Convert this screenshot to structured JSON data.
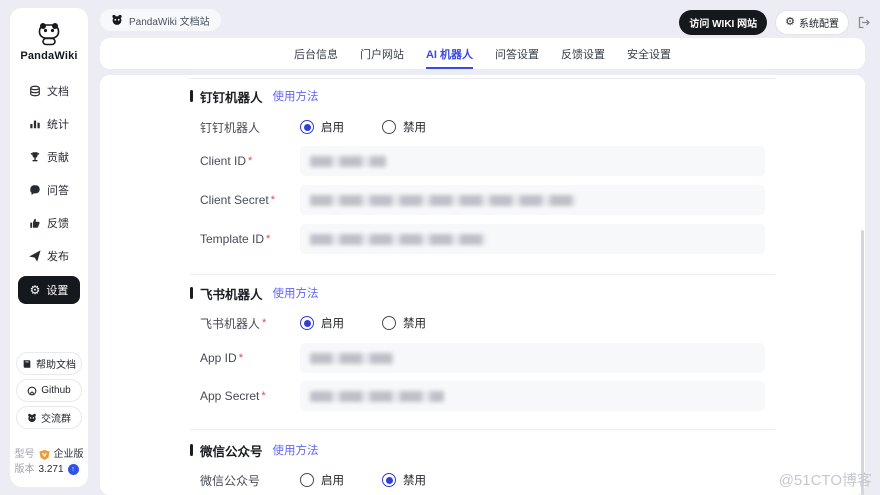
{
  "brand": {
    "name": "PandaWiki"
  },
  "topbar": {
    "breadcrumb": "PandaWiki 文档站",
    "visit_button": "访问 WIKI 网站",
    "system_config": "系统配置"
  },
  "tabs": {
    "active_index": 2,
    "items": [
      "后台信息",
      "门户网站",
      "AI 机器人",
      "问答设置",
      "反馈设置",
      "安全设置"
    ]
  },
  "sidebar": {
    "items": [
      {
        "label": "文档"
      },
      {
        "label": "统计"
      },
      {
        "label": "贡献"
      },
      {
        "label": "问答"
      },
      {
        "label": "反馈"
      },
      {
        "label": "发布"
      },
      {
        "label": "设置"
      }
    ],
    "footer_buttons": [
      {
        "label": "帮助文档"
      },
      {
        "label": "Github"
      },
      {
        "label": "交流群"
      }
    ],
    "model_label": "型号",
    "model_value": "企业版",
    "version_label": "版本",
    "version_value": "3.271"
  },
  "sections": [
    {
      "title": "钉钉机器人",
      "usage_link": "使用方法",
      "toggle_label": "钉钉机器人",
      "toggle_mark": "",
      "enabled": true,
      "radio_on": "启用",
      "radio_off": "禁用",
      "fields": [
        {
          "label": "Client ID",
          "mark": "*",
          "mask_width": 76
        },
        {
          "label": "Client Secret",
          "mark": "*",
          "mask_width": 266
        },
        {
          "label": "Template ID",
          "mark": "*",
          "mask_width": 176
        }
      ]
    },
    {
      "title": "飞书机器人",
      "usage_link": "使用方法",
      "toggle_label": "飞书机器人",
      "toggle_mark": "*",
      "enabled": true,
      "radio_on": "启用",
      "radio_off": "禁用",
      "fields": [
        {
          "label": "App ID",
          "mark": "*",
          "mask_width": 84
        },
        {
          "label": "App Secret",
          "mark": "*",
          "mask_width": 134
        }
      ]
    },
    {
      "title": "微信公众号",
      "usage_link": "使用方法",
      "toggle_label": "微信公众号",
      "toggle_mark": "",
      "enabled": false,
      "radio_on": "启用",
      "radio_off": "禁用",
      "fields": []
    }
  ],
  "watermark": "@51CTO博客",
  "colors": {
    "primary": "#3B4AE0",
    "link": "#6065F2",
    "dark": "#15181D",
    "page_bg": "#ECEDF4"
  }
}
